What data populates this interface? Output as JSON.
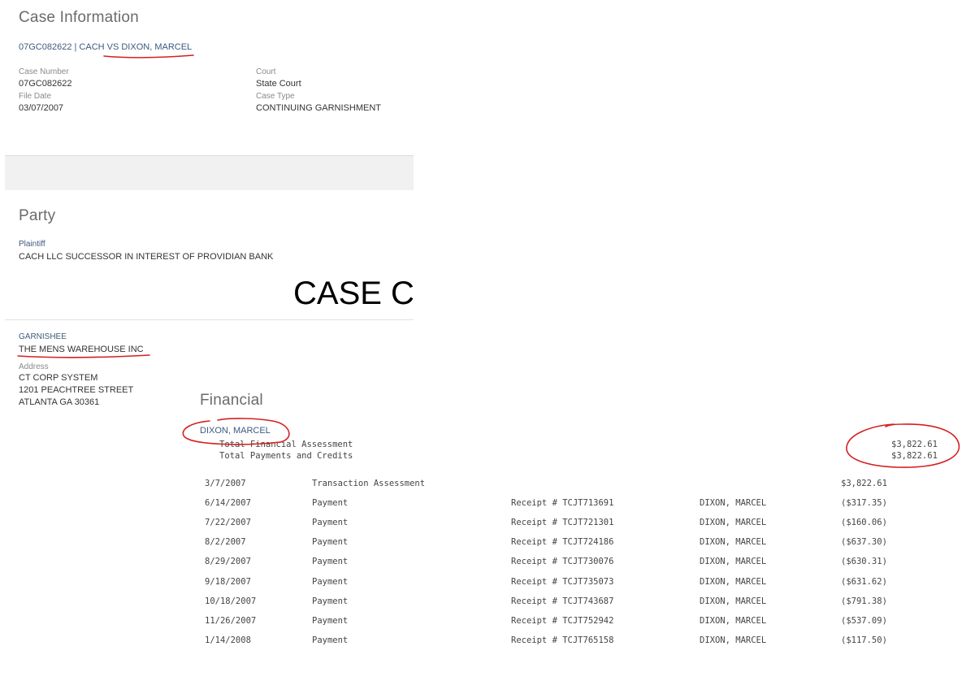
{
  "case_info": {
    "heading": "Case Information",
    "case_title_link": "07GC082622 | CACH VS DIXON, MARCEL",
    "case_number_label": "Case Number",
    "case_number": "07GC082622",
    "court_label": "Court",
    "court": "State Court",
    "file_date_label": "File Date",
    "file_date": "03/07/2007",
    "case_type_label": "Case Type",
    "case_type": "CONTINUING GARNISHMENT"
  },
  "party": {
    "heading": "Party",
    "plaintiff_label": "Plaintiff",
    "plaintiff_name": "CACH LLC SUCCESSOR IN INTEREST OF PROVIDIAN BANK",
    "overlay_text": "CASE C",
    "garnishee_label": "GARNISHEE",
    "garnishee_name": "THE MENS WAREHOUSE INC",
    "address_label": "Address",
    "address_line1": "CT CORP SYSTEM",
    "address_line2": "1201 PEACHTREE STREET",
    "address_line3": "ATLANTA GA 30361"
  },
  "financial": {
    "heading": "Financial",
    "party_link": "DIXON, MARCEL",
    "total_assessment_label": "Total Financial Assessment",
    "total_assessment": "$3,822.61",
    "total_payments_label": "Total Payments and Credits",
    "total_payments": "$3,822.61",
    "transactions": [
      {
        "date": "3/7/2007",
        "type": "Transaction Assessment",
        "receipt": "",
        "payor": "",
        "amount": "$3,822.61"
      },
      {
        "date": "6/14/2007",
        "type": "Payment",
        "receipt": "Receipt # TCJT713691",
        "payor": "DIXON, MARCEL",
        "amount": "($317.35)"
      },
      {
        "date": "7/22/2007",
        "type": "Payment",
        "receipt": "Receipt # TCJT721301",
        "payor": "DIXON, MARCEL",
        "amount": "($160.06)"
      },
      {
        "date": "8/2/2007",
        "type": "Payment",
        "receipt": "Receipt # TCJT724186",
        "payor": "DIXON, MARCEL",
        "amount": "($637.30)"
      },
      {
        "date": "8/29/2007",
        "type": "Payment",
        "receipt": "Receipt # TCJT730076",
        "payor": "DIXON, MARCEL",
        "amount": "($630.31)"
      },
      {
        "date": "9/18/2007",
        "type": "Payment",
        "receipt": "Receipt # TCJT735073",
        "payor": "DIXON, MARCEL",
        "amount": "($631.62)"
      },
      {
        "date": "10/18/2007",
        "type": "Payment",
        "receipt": "Receipt # TCJT743687",
        "payor": "DIXON, MARCEL",
        "amount": "($791.38)"
      },
      {
        "date": "11/26/2007",
        "type": "Payment",
        "receipt": "Receipt # TCJT752942",
        "payor": "DIXON, MARCEL",
        "amount": "($537.09)"
      },
      {
        "date": "1/14/2008",
        "type": "Payment",
        "receipt": "Receipt # TCJT765158",
        "payor": "DIXON, MARCEL",
        "amount": "($117.50)"
      }
    ]
  },
  "annotation_color": "#d42020"
}
